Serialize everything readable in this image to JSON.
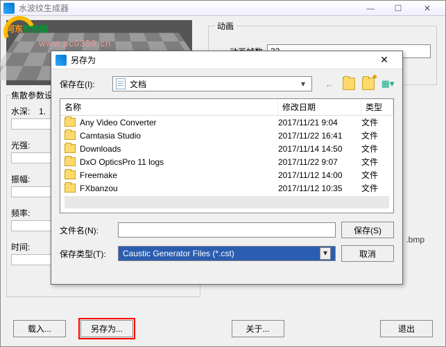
{
  "main": {
    "title": "水波纹生成器",
    "watermark_cn1": "河东",
    "watermark_cn2": "软件园",
    "watermark_url": "www.pc0359.cn"
  },
  "anim": {
    "legend": "动画",
    "frames_label": "动画帧数",
    "frames_value": "32"
  },
  "params": {
    "legend": "焦散参数设",
    "depth_label": "水深:",
    "depth_value": "1.",
    "intensity_label": "光强:",
    "amplitude_label": "振幅:",
    "frequency_label": "频率:",
    "time_label": "时间:"
  },
  "ext_hint": ".bmp",
  "buttons": {
    "load": "载入...",
    "saveas": "另存为...",
    "about": "关于...",
    "exit": "退出"
  },
  "dialog": {
    "title": "另存为",
    "savein_label": "保存在(I):",
    "folder_name": "文档",
    "cols": {
      "name": "名称",
      "date": "修改日期",
      "type": "类型"
    },
    "files": [
      {
        "name": "Any Video Converter",
        "date": "2017/11/21 9:04",
        "type": "文件"
      },
      {
        "name": "Camtasia Studio",
        "date": "2017/11/22 16:41",
        "type": "文件"
      },
      {
        "name": "Downloads",
        "date": "2017/11/14 14:50",
        "type": "文件"
      },
      {
        "name": "DxO OpticsPro 11 logs",
        "date": "2017/11/22 9:07",
        "type": "文件"
      },
      {
        "name": "Freemake",
        "date": "2017/11/12 14:00",
        "type": "文件"
      },
      {
        "name": "FXbanzou",
        "date": "2017/11/12 10:35",
        "type": "文件"
      }
    ],
    "filename_label": "文件名(N):",
    "filename_value": "",
    "filetype_label": "保存类型(T):",
    "filetype_value": "Caustic Generator Files (*.cst)",
    "save_btn": "保存(S)",
    "cancel_btn": "取消"
  }
}
